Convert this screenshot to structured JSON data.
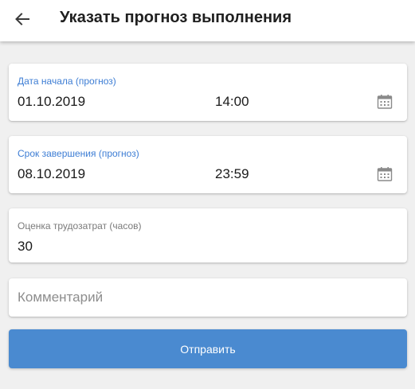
{
  "header": {
    "title": "Указать прогноз выполнения",
    "back_icon": "arrow-left-icon"
  },
  "form": {
    "start": {
      "label": "Дата начала (прогноз)",
      "date": "01.10.2019",
      "time": "14:00",
      "icon": "calendar-icon"
    },
    "end": {
      "label": "Срок завершения (прогноз)",
      "date": "08.10.2019",
      "time": "23:59",
      "icon": "calendar-icon"
    },
    "effort": {
      "label": "Оценка трудозатрат (часов)",
      "value": "30"
    },
    "comment": {
      "placeholder": "Комментарий",
      "value": ""
    },
    "submit_label": "Отправить"
  },
  "colors": {
    "accent": "#3d7dd4",
    "button": "#4a8ad0",
    "background": "#f0f0f0"
  }
}
